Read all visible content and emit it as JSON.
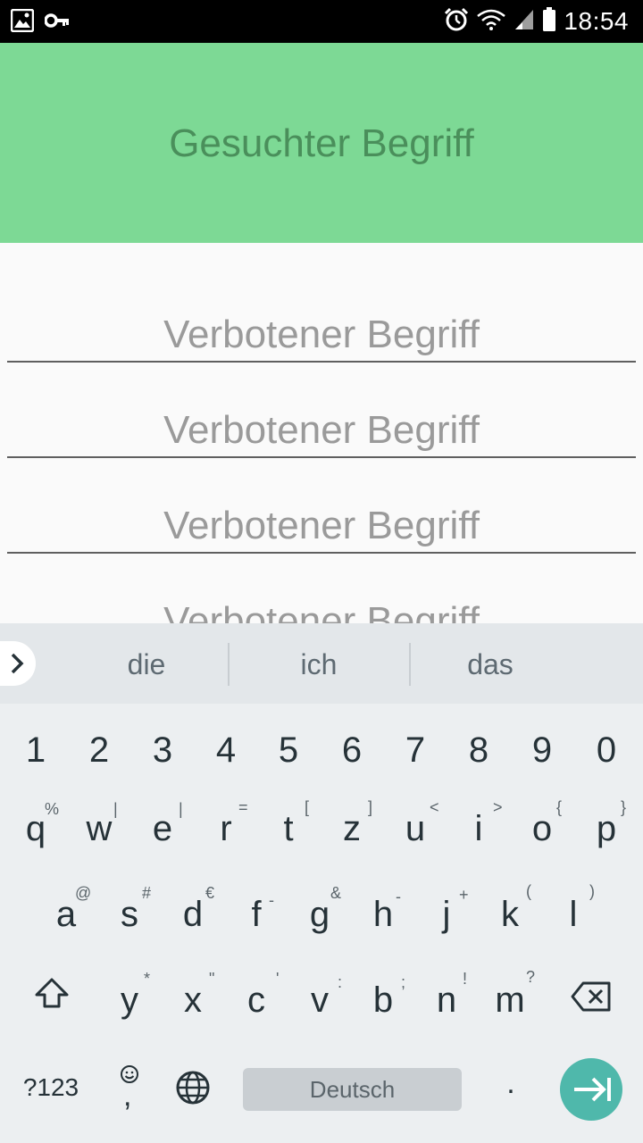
{
  "status_bar": {
    "time": "18:54",
    "icons": [
      "image-icon",
      "key-icon",
      "alarm-icon",
      "wifi-icon",
      "signal-icon",
      "battery-icon"
    ]
  },
  "header": {
    "title": "Gesuchter Begriff",
    "background_color": "#7dd995"
  },
  "fields": [
    {
      "placeholder": "Verbotener Begriff"
    },
    {
      "placeholder": "Verbotener Begriff"
    },
    {
      "placeholder": "Verbotener Begriff"
    },
    {
      "placeholder": "Verbotener Begriff"
    }
  ],
  "keyboard": {
    "suggestions": [
      "die",
      "ich",
      "das"
    ],
    "number_row": [
      "1",
      "2",
      "3",
      "4",
      "5",
      "6",
      "7",
      "8",
      "9",
      "0"
    ],
    "row1": [
      {
        "key": "q",
        "hint": "%"
      },
      {
        "key": "w",
        "hint": "\\"
      },
      {
        "key": "e",
        "hint": "|"
      },
      {
        "key": "r",
        "hint": "="
      },
      {
        "key": "t",
        "hint": "["
      },
      {
        "key": "z",
        "hint": "]"
      },
      {
        "key": "u",
        "hint": "<"
      },
      {
        "key": "i",
        "hint": ">"
      },
      {
        "key": "o",
        "hint": "{"
      },
      {
        "key": "p",
        "hint": "}"
      }
    ],
    "row2": [
      {
        "key": "a",
        "hint": "@"
      },
      {
        "key": "s",
        "hint": "#"
      },
      {
        "key": "d",
        "hint": "€"
      },
      {
        "key": "f",
        "hint": "-"
      },
      {
        "key": "g",
        "hint": "&"
      },
      {
        "key": "h",
        "hint": "-"
      },
      {
        "key": "j",
        "hint": "+"
      },
      {
        "key": "k",
        "hint": "("
      },
      {
        "key": "l",
        "hint": ")"
      }
    ],
    "row3": [
      {
        "key": "y",
        "hint": "*"
      },
      {
        "key": "x",
        "hint": "\""
      },
      {
        "key": "c",
        "hint": "'"
      },
      {
        "key": "v",
        "hint": ":"
      },
      {
        "key": "b",
        "hint": ";"
      },
      {
        "key": "n",
        "hint": "!"
      },
      {
        "key": "m",
        "hint": "?"
      }
    ],
    "symbols_label": "?123",
    "comma": ",",
    "space_label": "Deutsch",
    "period": ".",
    "enter_color": "#4fb8ab"
  }
}
